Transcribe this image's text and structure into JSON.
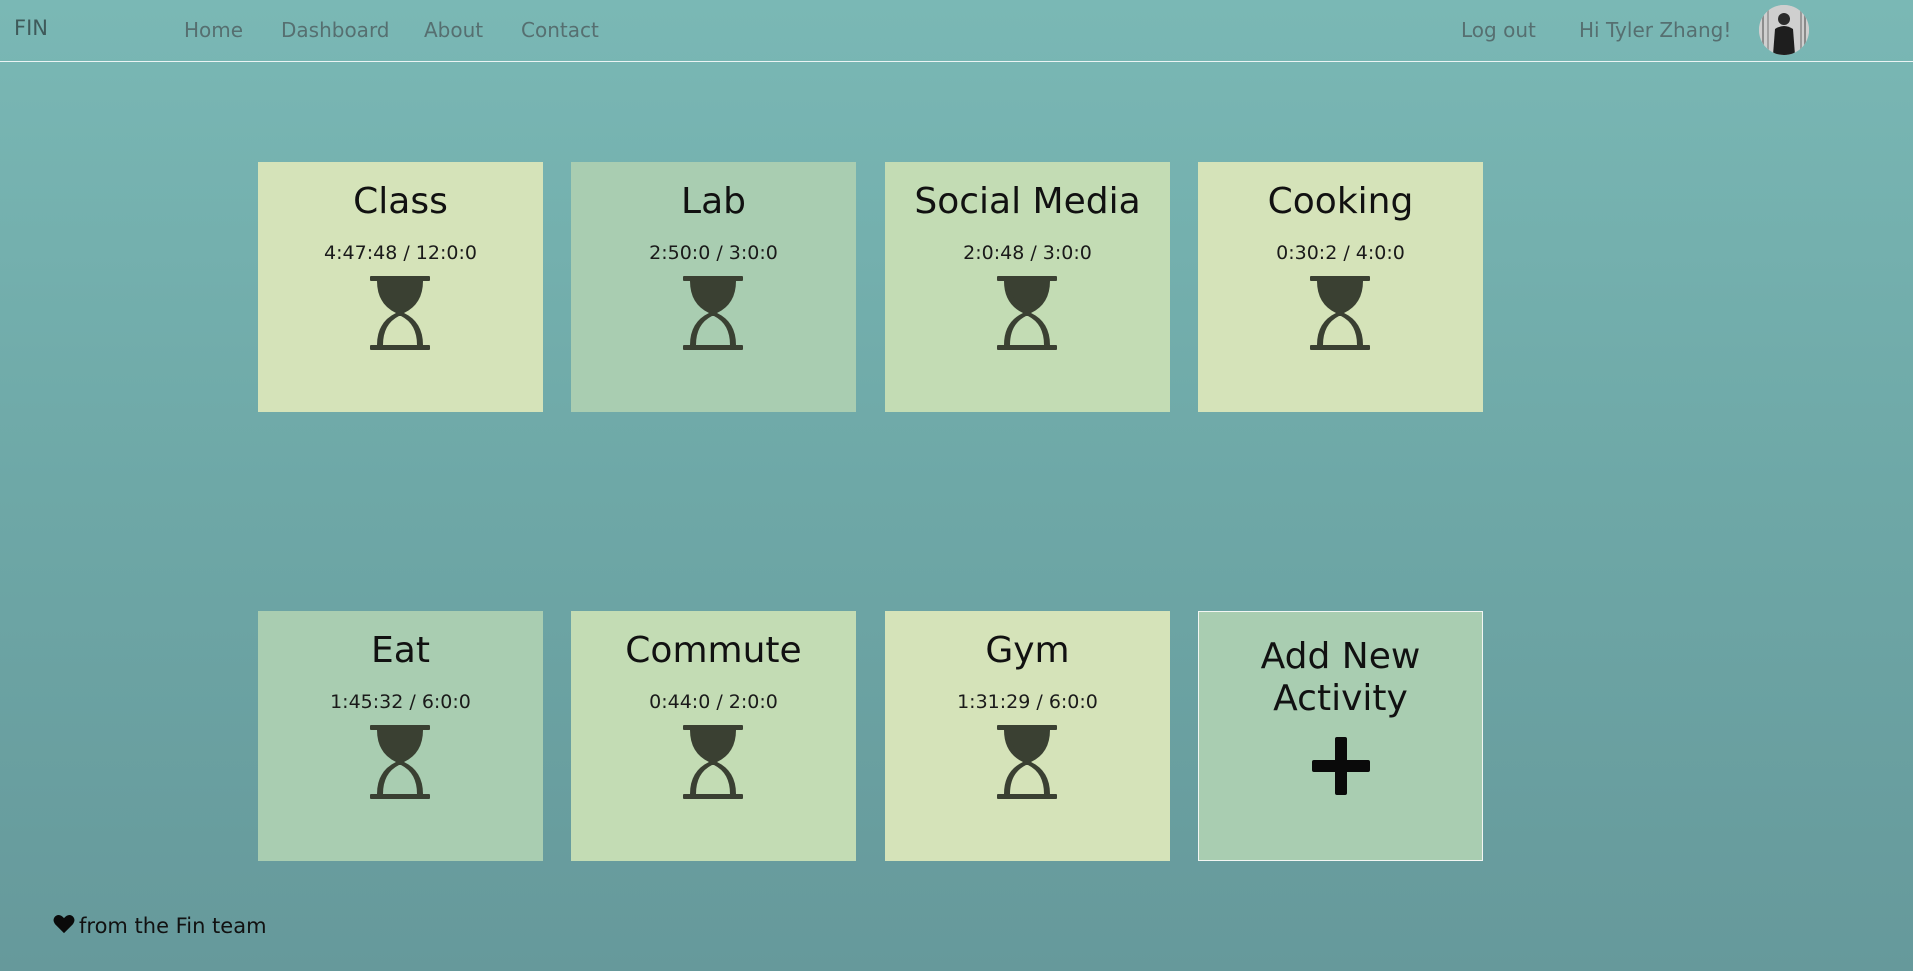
{
  "nav": {
    "brand": "FIN",
    "links": [
      "Home",
      "Dashboard",
      "About",
      "Contact"
    ],
    "logout": "Log out",
    "greeting": "Hi Tyler Zhang!"
  },
  "activities": [
    {
      "title": "Class",
      "time": "4:47:48 / 12:0:0",
      "color": "#d5e3b9"
    },
    {
      "title": "Lab",
      "time": "2:50:0 / 3:0:0",
      "color": "#a9cdb1"
    },
    {
      "title": "Social Media",
      "time": "2:0:48 / 3:0:0",
      "color": "#c3dcb4"
    },
    {
      "title": "Cooking",
      "time": "0:30:2 / 4:0:0",
      "color": "#d5e3b9"
    },
    {
      "title": "Eat",
      "time": "1:45:32 / 6:0:0",
      "color": "#a9cdb1"
    },
    {
      "title": "Commute",
      "time": "0:44:0 / 2:0:0",
      "color": "#c3dcb4"
    },
    {
      "title": "Gym",
      "time": "1:31:29 / 6:0:0",
      "color": "#d5e3b9"
    }
  ],
  "add_card": {
    "line1": "Add New",
    "line2": "Activity",
    "color": "#a9cdb1"
  },
  "icons": {
    "activity": "hourglass-icon",
    "add": "plus-icon",
    "footer": "heart-icon"
  },
  "footer": {
    "text": "from the Fin team"
  }
}
